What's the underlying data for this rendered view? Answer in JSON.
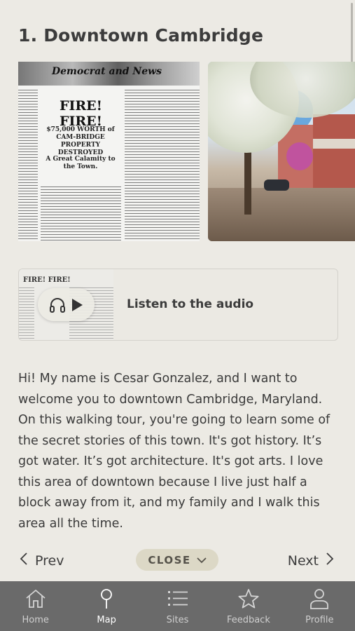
{
  "page": {
    "title": "1. Downtown Cambridge"
  },
  "hero": {
    "newspaper": {
      "masthead": "Democrat  and  News",
      "headline": "FIRE! FIRE!",
      "subhead": "$75,000 WORTH of CAM-BRIDGE PROPERTY DESTROYED",
      "subhead2": "A Great Calamity to the Town."
    }
  },
  "audio": {
    "thumb_text": "FIRE! FIRE!",
    "label": "Listen to the audio",
    "icons": [
      "headphones-icon",
      "play-icon"
    ]
  },
  "body": {
    "text": "Hi! My name is Cesar Gonzalez, and I want to welcome you to downtown Cambridge, Maryland. On this walking tour, you're going to learn some of the secret stories of this town. It's got history. It’s got water. It’s got architecture. It's got arts. I love this area of downtown because I live just half a block away from it, and my family and I walk this area all the time."
  },
  "pager": {
    "prev_label": "Prev",
    "close_label": "CLOSE",
    "next_label": "Next"
  },
  "tabbar": {
    "items": [
      {
        "label": "Home",
        "icon": "home-icon",
        "active": false
      },
      {
        "label": "Map",
        "icon": "map-pin-icon",
        "active": true
      },
      {
        "label": "Sites",
        "icon": "list-icon",
        "active": false
      },
      {
        "label": "Feedback",
        "icon": "star-icon",
        "active": false
      },
      {
        "label": "Profile",
        "icon": "person-icon",
        "active": false
      }
    ]
  },
  "colors": {
    "background": "#eceae4",
    "tabbar": "#6a6a6a",
    "close_pill": "#dcd8c6",
    "text": "#3a3a3a"
  }
}
